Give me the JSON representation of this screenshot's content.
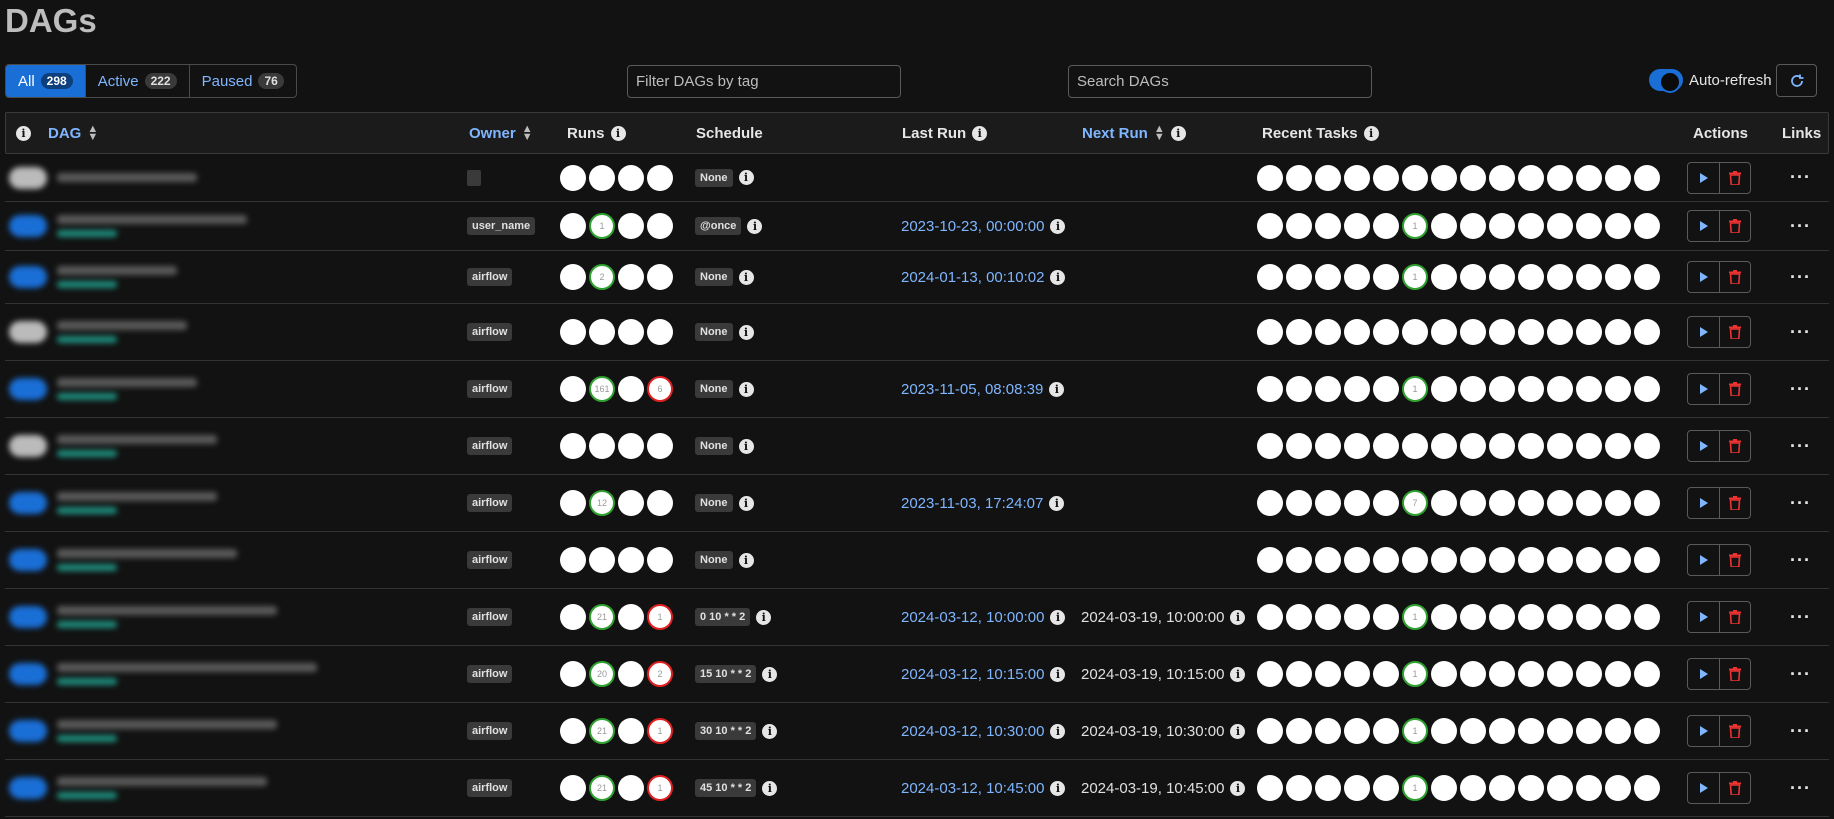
{
  "page": {
    "title": "DAGs"
  },
  "filters": {
    "tabs": [
      {
        "label": "All",
        "count": "298"
      },
      {
        "label": "Active",
        "count": "222"
      },
      {
        "label": "Paused",
        "count": "76"
      }
    ],
    "tag_placeholder": "Filter DAGs by tag",
    "search_placeholder": "Search DAGs",
    "auto_refresh_label": "Auto-refresh"
  },
  "columns": {
    "dag": "DAG",
    "owner": "Owner",
    "runs": "Runs",
    "schedule": "Schedule",
    "last_run": "Last Run",
    "next_run": "Next Run",
    "recent_tasks": "Recent Tasks",
    "actions": "Actions",
    "links": "Links"
  },
  "colors": {
    "accent": "#1a6fd6",
    "link": "#7fb6ff",
    "success": "#2fa12f",
    "failed": "#e02020",
    "tag": "#1e8c7c"
  },
  "rows": [
    {
      "toggle_color": "#bbbbbb",
      "owner": "",
      "runs": [
        "",
        "",
        "",
        ""
      ],
      "runs_style": [
        "",
        "",
        "",
        ""
      ],
      "schedule": "None",
      "last_run": "",
      "next_run": "",
      "task_mark_index": -1,
      "task_mark_value": ""
    },
    {
      "toggle_color": "#1a6fd6",
      "owner": "user_name",
      "runs": [
        "",
        "1",
        "",
        ""
      ],
      "runs_style": [
        "",
        "green",
        "",
        ""
      ],
      "schedule": "@once",
      "last_run": "2023-10-23, 00:00:00",
      "next_run": "",
      "task_mark_index": 5,
      "task_mark_value": "1"
    },
    {
      "toggle_color": "#1a6fd6",
      "owner": "airflow",
      "runs": [
        "",
        "2",
        "",
        ""
      ],
      "runs_style": [
        "",
        "green",
        "",
        ""
      ],
      "schedule": "None",
      "last_run": "2024-01-13, 00:10:02",
      "next_run": "",
      "task_mark_index": 5,
      "task_mark_value": "1"
    },
    {
      "toggle_color": "#bbbbbb",
      "owner": "airflow",
      "runs": [
        "",
        "",
        "",
        ""
      ],
      "runs_style": [
        "",
        "",
        "",
        ""
      ],
      "schedule": "None",
      "last_run": "",
      "next_run": "",
      "task_mark_index": -1,
      "task_mark_value": ""
    },
    {
      "toggle_color": "#1a6fd6",
      "owner": "airflow",
      "runs": [
        "",
        "161",
        "",
        "6"
      ],
      "runs_style": [
        "",
        "green",
        "",
        "red"
      ],
      "schedule": "None",
      "last_run": "2023-11-05, 08:08:39",
      "next_run": "",
      "task_mark_index": 5,
      "task_mark_value": "1"
    },
    {
      "toggle_color": "#bbbbbb",
      "owner": "airflow",
      "runs": [
        "",
        "",
        "",
        ""
      ],
      "runs_style": [
        "",
        "",
        "",
        ""
      ],
      "schedule": "None",
      "last_run": "",
      "next_run": "",
      "task_mark_index": -1,
      "task_mark_value": ""
    },
    {
      "toggle_color": "#1a6fd6",
      "owner": "airflow",
      "runs": [
        "",
        "12",
        "",
        ""
      ],
      "runs_style": [
        "",
        "green",
        "",
        ""
      ],
      "schedule": "None",
      "last_run": "2023-11-03, 17:24:07",
      "next_run": "",
      "task_mark_index": 5,
      "task_mark_value": "7"
    },
    {
      "toggle_color": "#1a6fd6",
      "owner": "airflow",
      "runs": [
        "",
        "",
        "",
        ""
      ],
      "runs_style": [
        "",
        "",
        "",
        ""
      ],
      "schedule": "None",
      "last_run": "",
      "next_run": "",
      "task_mark_index": -1,
      "task_mark_value": ""
    },
    {
      "toggle_color": "#1a6fd6",
      "owner": "airflow",
      "runs": [
        "",
        "21",
        "",
        "1"
      ],
      "runs_style": [
        "",
        "green",
        "",
        "red"
      ],
      "schedule": "0 10 * * 2",
      "last_run": "2024-03-12, 10:00:00",
      "next_run": "2024-03-19, 10:00:00",
      "task_mark_index": 5,
      "task_mark_value": "1"
    },
    {
      "toggle_color": "#1a6fd6",
      "owner": "airflow",
      "runs": [
        "",
        "20",
        "",
        "2"
      ],
      "runs_style": [
        "",
        "green",
        "",
        "red"
      ],
      "schedule": "15 10 * * 2",
      "last_run": "2024-03-12, 10:15:00",
      "next_run": "2024-03-19, 10:15:00",
      "task_mark_index": 5,
      "task_mark_value": "1"
    },
    {
      "toggle_color": "#1a6fd6",
      "owner": "airflow",
      "runs": [
        "",
        "21",
        "",
        "1"
      ],
      "runs_style": [
        "",
        "green",
        "",
        "red"
      ],
      "schedule": "30 10 * * 2",
      "last_run": "2024-03-12, 10:30:00",
      "next_run": "2024-03-19, 10:30:00",
      "task_mark_index": 5,
      "task_mark_value": "1"
    },
    {
      "toggle_color": "#1a6fd6",
      "owner": "airflow",
      "runs": [
        "",
        "21",
        "",
        "1"
      ],
      "runs_style": [
        "",
        "green",
        "",
        "red"
      ],
      "schedule": "45 10 * * 2",
      "last_run": "2024-03-12, 10:45:00",
      "next_run": "2024-03-19, 10:45:00",
      "task_mark_index": 5,
      "task_mark_value": "1"
    }
  ]
}
